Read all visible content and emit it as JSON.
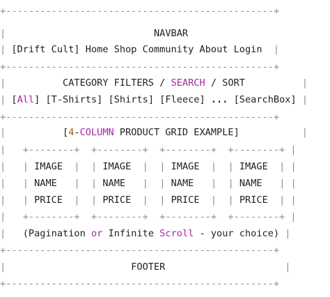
{
  "navbar": {
    "title": "NAVBAR",
    "links": [
      "[Drift Cult]",
      "Home",
      "Shop",
      "Community",
      "About",
      "Login"
    ]
  },
  "filters": {
    "title_parts": [
      "CATEGORY FILTERS",
      "/",
      "SEARCH",
      "/",
      "SORT"
    ],
    "options": [
      "[",
      "All",
      "]",
      "[T-Shirts]",
      "[Shirts]",
      "[Fleece]",
      "...",
      "[SearchBox]"
    ]
  },
  "grid": {
    "title_parts": [
      "[",
      "4",
      "-",
      "COLUMN",
      "PRODUCT GRID EXAMPLE]"
    ],
    "cards": [
      {
        "image": "IMAGE",
        "name": "NAME",
        "price": "PRICE"
      },
      {
        "image": "IMAGE",
        "name": "NAME",
        "price": "PRICE"
      },
      {
        "image": "IMAGE",
        "name": "NAME",
        "price": "PRICE"
      },
      {
        "image": "IMAGE",
        "name": "NAME",
        "price": "PRICE"
      }
    ],
    "pagination_parts": [
      "(Pagination",
      "or",
      "Infinite",
      "Scroll",
      "- your choice)"
    ]
  },
  "footer": {
    "title": "FOOTER"
  },
  "colors": {
    "keyword": "#a626a4",
    "number": "#986801",
    "border": "#8c8c8c",
    "text": "#1f1f1f"
  }
}
